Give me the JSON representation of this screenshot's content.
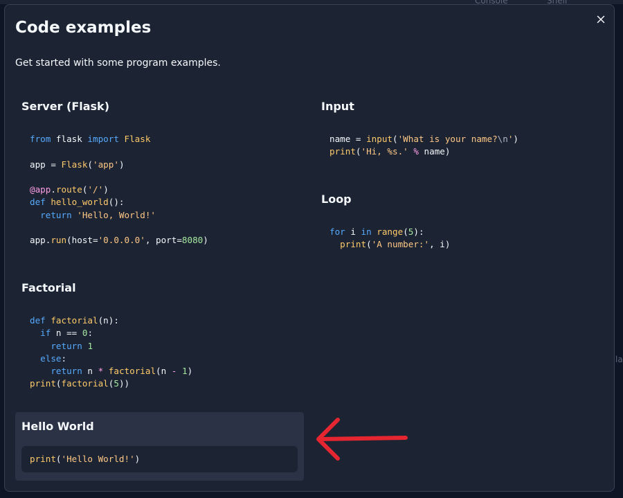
{
  "background": {
    "tabs": [
      "Console",
      "Shell"
    ]
  },
  "modal": {
    "title": "Code examples",
    "subtitle": "Get started with some program examples.",
    "close_icon": "close-icon"
  },
  "examples": [
    {
      "id": "flask",
      "title": "Server (Flask)"
    },
    {
      "id": "input",
      "title": "Input"
    },
    {
      "id": "loop",
      "title": "Loop"
    },
    {
      "id": "factorial",
      "title": "Factorial"
    },
    {
      "id": "hello",
      "title": "Hello World"
    }
  ],
  "code": {
    "flask": [
      "from flask import Flask",
      "",
      "app = Flask('app')",
      "",
      "@app.route('/')",
      "def hello_world():",
      "  return 'Hello, World!'",
      "",
      "app.run(host='0.0.0.0', port=8080)"
    ],
    "input": [
      "name = input('What is your name?\\n')",
      "print('Hi, %s.' % name)"
    ],
    "loop": [
      "for i in range(5):",
      "  print('A number:', i)"
    ],
    "factorial": [
      "def factorial(n):",
      "  if n == 0:",
      "    return 1",
      "  else:",
      "    return n * factorial(n - 1)",
      "print(factorial(5))"
    ],
    "hello": [
      "print('Hello World!')"
    ]
  },
  "annotation": {
    "arrow_color": "#e5252f"
  },
  "colors": {
    "panel": "#1c2333",
    "highlight": "#2b3245",
    "keyword": "#57abff",
    "function": "#ffcb6b",
    "string": "#ffc885",
    "number": "#a6e9a1"
  }
}
